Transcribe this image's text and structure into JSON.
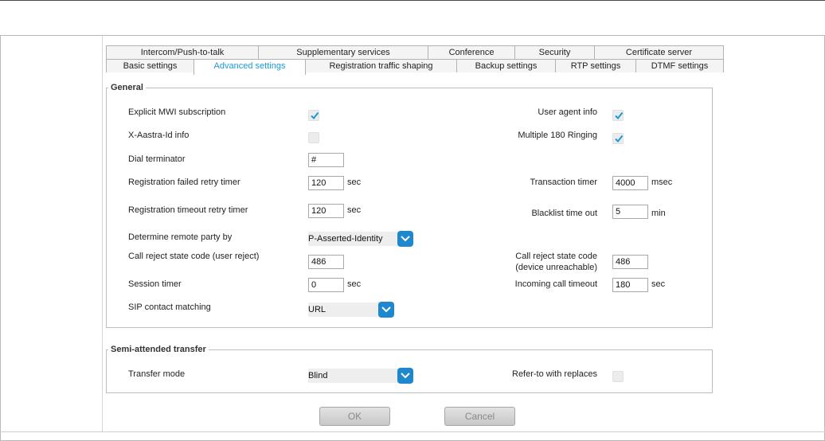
{
  "tabs_row1": [
    "Intercom/Push-to-talk",
    "Supplementary services",
    "Conference",
    "Security",
    "Certificate server"
  ],
  "tabs_row2": [
    "Basic settings",
    "Advanced settings",
    "Registration traffic shaping",
    "Backup settings",
    "RTP settings",
    "DTMF settings"
  ],
  "active_tab": "Advanced settings",
  "general": {
    "legend": "General",
    "explicit_mwi": {
      "label": "Explicit MWI subscription",
      "checked": true
    },
    "user_agent_info": {
      "label": "User agent info",
      "checked": true
    },
    "xaastra_id": {
      "label": "X-Aastra-Id info",
      "checked": false
    },
    "multiple_180": {
      "label": "Multiple 180 Ringing",
      "checked": true
    },
    "dial_terminator": {
      "label": "Dial terminator",
      "value": "#"
    },
    "reg_failed_retry": {
      "label": "Registration failed retry timer",
      "value": "120",
      "unit": "sec"
    },
    "transaction_timer": {
      "label": "Transaction timer",
      "value": "4000",
      "unit": "msec"
    },
    "reg_timeout_retry": {
      "label": "Registration timeout retry timer",
      "value": "120",
      "unit": "sec"
    },
    "blacklist_timeout": {
      "label": "Blacklist time out",
      "value": "5",
      "unit": "min"
    },
    "remote_party": {
      "label": "Determine remote party by",
      "value": "P-Asserted-Identity"
    },
    "reject_user": {
      "label": "Call reject state code (user reject)",
      "value": "486"
    },
    "reject_device": {
      "label_line1": "Call reject state code",
      "label_line2": "(device unreachable)",
      "value": "486"
    },
    "session_timer": {
      "label": "Session timer",
      "value": "0",
      "unit": "sec"
    },
    "incoming_timeout": {
      "label": "Incoming call timeout",
      "value": "180",
      "unit": "sec"
    },
    "sip_contact": {
      "label": "SIP contact matching",
      "value": "URL"
    }
  },
  "semi": {
    "legend": "Semi-attended transfer",
    "transfer_mode": {
      "label": "Transfer mode",
      "value": "Blind"
    },
    "refer_to": {
      "label": "Refer-to with replaces",
      "checked": false
    }
  },
  "buttons": {
    "ok": "OK",
    "cancel": "Cancel"
  },
  "colors": {
    "accent": "#1e88cf",
    "active_tab_text": "#1a9bd7",
    "check": "#1a9bd7"
  },
  "icons": {
    "checkbox_check": "check-icon",
    "select_arrow": "chevron-down-icon"
  }
}
